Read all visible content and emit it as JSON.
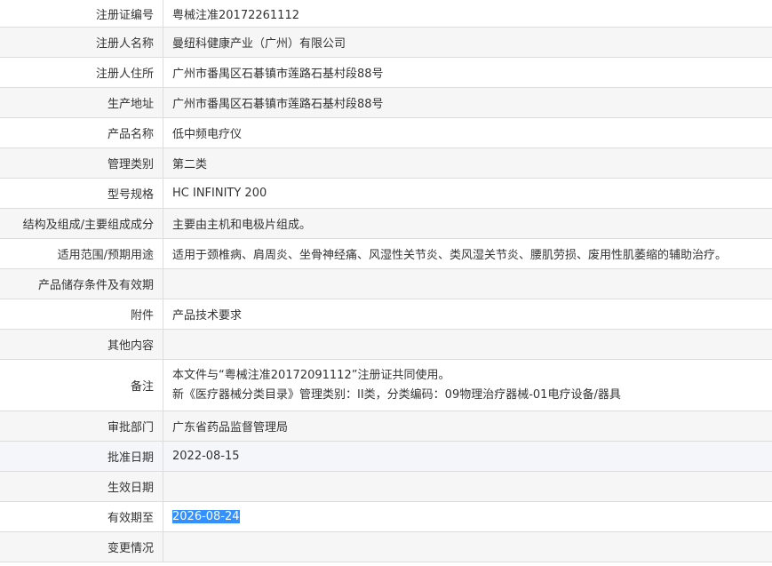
{
  "rows": [
    {
      "label": "注册证编号",
      "value": "粤械注准20172261112"
    },
    {
      "label": "注册人名称",
      "value": "曼纽科健康产业（广州）有限公司"
    },
    {
      "label": "注册人住所",
      "value": "广州市番禺区石碁镇市莲路石基村段88号"
    },
    {
      "label": "生产地址",
      "value": "广州市番禺区石碁镇市莲路石基村段88号"
    },
    {
      "label": "产品名称",
      "value": "低中频电疗仪"
    },
    {
      "label": "管理类别",
      "value": "第二类"
    },
    {
      "label": "型号规格",
      "value": "HC INFINITY 200"
    },
    {
      "label": "结构及组成/主要组成成分",
      "value": "主要由主机和电极片组成。"
    },
    {
      "label": "适用范围/预期用途",
      "value": "适用于颈椎病、肩周炎、坐骨神经痛、风湿性关节炎、类风湿关节炎、腰肌劳损、废用性肌萎缩的辅助治疗。"
    },
    {
      "label": "产品储存条件及有效期",
      "value": ""
    },
    {
      "label": "附件",
      "value": "产品技术要求"
    },
    {
      "label": "其他内容",
      "value": ""
    },
    {
      "label": "备注",
      "lines": [
        "本文件与“粤械注准20172091112”注册证共同使用。",
        "新《医疗器械分类目录》管理类别：II类，分类编码：09物理治疗器械-01电疗设备/器具"
      ]
    },
    {
      "label": "审批部门",
      "value": "广东省药品监督管理局"
    },
    {
      "label": "批准日期",
      "value": "2022-08-15"
    },
    {
      "label": "生效日期",
      "value": ""
    },
    {
      "label": "有效期至",
      "value": "2026-08-24"
    },
    {
      "label": "变更情况",
      "value": ""
    }
  ]
}
